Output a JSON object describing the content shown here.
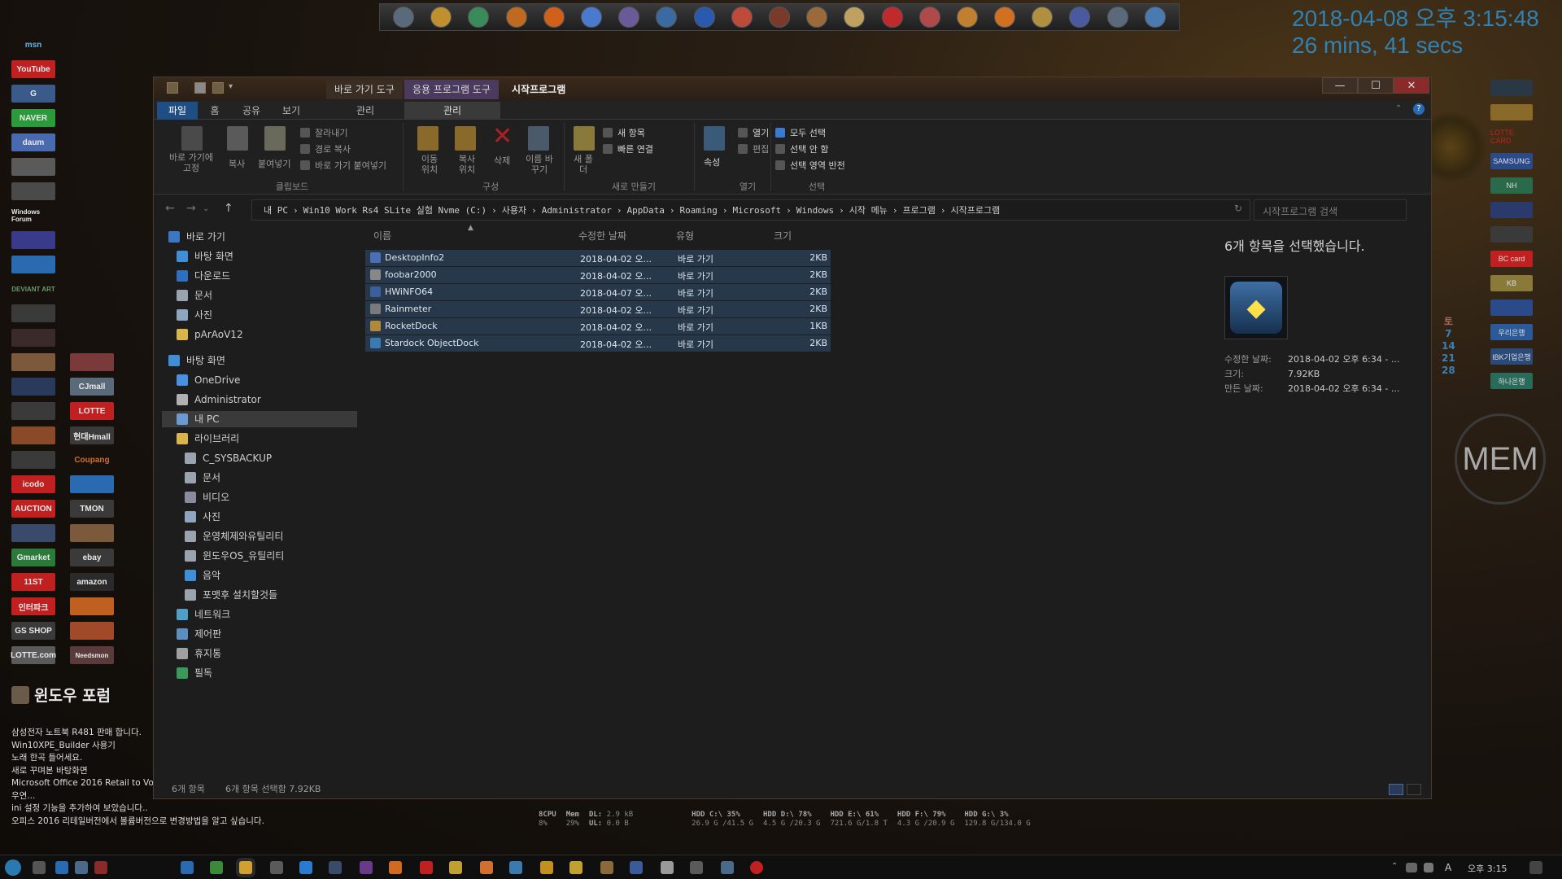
{
  "clock": {
    "datetime": "2018-04-08 오후 3:15:48",
    "uptime": "26 mins, 41 secs"
  },
  "left_shortcuts": [
    "msn",
    "YouTube",
    "G",
    "NAVER",
    "daum",
    "",
    "",
    "Windows Forum",
    "",
    "",
    "DEVIANT ART",
    "",
    "",
    "",
    "",
    "",
    "",
    "",
    "",
    "",
    "",
    "",
    "",
    "",
    "",
    ""
  ],
  "left_shortcuts_col2": [
    "CJmall",
    "LOTTE",
    "현대Hmall",
    "Coupang",
    "",
    "TMON",
    "",
    "ebay",
    "amazon",
    "",
    "",
    "Needsmon"
  ],
  "left_shortcuts_col1b": [
    "icodo",
    "AUCTION",
    "",
    "Gmarket",
    "11ST",
    "인터파크",
    "GS SHOP",
    "LOTTE.com"
  ],
  "right_shortcuts": [
    "",
    "",
    "LOTTE CARD",
    "SAMSUNG",
    "NH",
    "",
    "",
    "BC card",
    "KB",
    "",
    "우리은행",
    "IBK기업은행",
    "하나은행"
  ],
  "calendar": [
    "토",
    "7",
    "14",
    "21",
    "28"
  ],
  "mem_widget": "MEM",
  "forum": {
    "title": "윈도우 포럼",
    "lines": [
      "삼성전자 노트북 R481 판매 합니다.",
      "Win10XPE_Builder 사용기",
      "노래 한곡 들어세요.",
      "새로 꾸며본 바탕화면",
      "Microsoft Office 2016 Retail to Vo",
      "우연...",
      "ini 설정 기능을 추가하여 보았습니다..",
      "오피스 2016 리테일버전에서 볼륨버전으로 변경방법을 알고 싶습니다."
    ]
  },
  "window": {
    "context_tabs": [
      "바로 가기 도구",
      "응용 프로그램 도구"
    ],
    "title": "시작프로그램",
    "controls": {
      "minimize": "—",
      "maximize": "☐",
      "close": "✕"
    },
    "tabs": {
      "file": "파일",
      "home": "홈",
      "share": "공유",
      "view": "보기",
      "manage1": "관리",
      "manage2": "관리"
    },
    "ribbon": {
      "pin": "바로 가기에 고정",
      "copy": "복사",
      "paste": "붙여넣기",
      "cut": "잘라내기",
      "copy_path": "경로 복사",
      "paste_shortcut": "바로 가기 붙여넣기",
      "move_to": "이동 위치",
      "copy_to": "복사 위치",
      "delete": "삭제",
      "rename": "이름 바꾸기",
      "new_folder": "새 폴더",
      "new_item": "새 항목",
      "easy_access": "빠른 연결",
      "properties": "속성",
      "open": "열기",
      "edit": "편집",
      "select_all": "모두 선택",
      "select_none": "선택 안 함",
      "invert_selection": "선택 영역 반전",
      "groups": {
        "clipboard": "클립보드",
        "organize": "구성",
        "new": "새로 만들기",
        "open": "열기",
        "select": "선택"
      }
    },
    "address": {
      "back": "←",
      "forward": "→",
      "dropdown": "⌄",
      "up": "↑",
      "crumbs": [
        "내 PC",
        "Win10 Work Rs4 SLite 실험 Nvme (C:)",
        "사용자",
        "Administrator",
        "AppData",
        "Roaming",
        "Microsoft",
        "Windows",
        "시작 메뉴",
        "프로그램",
        "시작프로그램"
      ],
      "refresh": "↻",
      "search_placeholder": "시작프로그램 검색"
    },
    "nav": [
      {
        "label": "바로 가기",
        "color": "#3b78c4"
      },
      {
        "label": "바탕 화면",
        "color": "#3f8fd8"
      },
      {
        "label": "다운로드",
        "color": "#2f6fbe"
      },
      {
        "label": "문서",
        "color": "#9aa4b0"
      },
      {
        "label": "사진",
        "color": "#8fa6c0"
      },
      {
        "label": "pArAoV12",
        "color": "#d9b54a"
      },
      {
        "label": "바탕 화면",
        "color": "#3f8fd8"
      },
      {
        "label": "OneDrive",
        "color": "#4a90e2"
      },
      {
        "label": "Administrator",
        "color": "#b0b0b0"
      },
      {
        "label": "내 PC",
        "color": "#6a9ad0"
      },
      {
        "label": "라이브러리",
        "color": "#d9b54a"
      },
      {
        "label": "C_SYSBACKUP",
        "color": "#9aa4b0"
      },
      {
        "label": "문서",
        "color": "#9aa4b0"
      },
      {
        "label": "비디오",
        "color": "#8a8aa0"
      },
      {
        "label": "사진",
        "color": "#8fa6c0"
      },
      {
        "label": "운영체제와유틸리티",
        "color": "#9aa4b0"
      },
      {
        "label": "윈도우OS_유틸리티",
        "color": "#9aa4b0"
      },
      {
        "label": "음악",
        "color": "#3f8fd8"
      },
      {
        "label": "포맷후 설치할것들",
        "color": "#9aa4b0"
      },
      {
        "label": "네트워크",
        "color": "#4fa0c8"
      },
      {
        "label": "제어판",
        "color": "#5a8fbf"
      },
      {
        "label": "휴지통",
        "color": "#a0a0a0"
      },
      {
        "label": "필독",
        "color": "#3a9a5a"
      }
    ],
    "columns": {
      "name": "이름",
      "modified": "수정한 날짜",
      "type": "유형",
      "size": "크기"
    },
    "files": [
      {
        "name": "DesktopInfo2",
        "modified": "2018-04-02 오...",
        "type": "바로 가기",
        "size": "2KB",
        "color": "#4a6fb5"
      },
      {
        "name": "foobar2000",
        "modified": "2018-04-02 오...",
        "type": "바로 가기",
        "size": "2KB",
        "color": "#888888"
      },
      {
        "name": "HWiNFO64",
        "modified": "2018-04-07 오...",
        "type": "바로 가기",
        "size": "2KB",
        "color": "#3b5f9a"
      },
      {
        "name": "Rainmeter",
        "modified": "2018-04-02 오...",
        "type": "바로 가기",
        "size": "2KB",
        "color": "#7a7a7a"
      },
      {
        "name": "RocketDock",
        "modified": "2018-04-02 오...",
        "type": "바로 가기",
        "size": "1KB",
        "color": "#b08a3a"
      },
      {
        "name": "Stardock ObjectDock",
        "modified": "2018-04-02 오...",
        "type": "바로 가기",
        "size": "2KB",
        "color": "#3a7ab0"
      }
    ],
    "details": {
      "title": "6개 항목을 선택했습니다.",
      "modified_label": "수정한 날짜:",
      "modified_value": "2018-04-02 오후 6:34 - ...",
      "size_label": "크기:",
      "size_value": "7.92KB",
      "created_label": "만든 날짜:",
      "created_value": "2018-04-02 오후 6:34 - ..."
    },
    "status": {
      "count": "6개 항목",
      "selected": "6개 항목 선택함 7.92KB"
    }
  },
  "stats": [
    {
      "label": "8CPU",
      "value": "8%"
    },
    {
      "label": "Mem",
      "value": "29%"
    },
    {
      "label": "DL:",
      "value": "2.9 kB"
    },
    {
      "label": "UL:",
      "value": "0.0 B"
    },
    {
      "label": "HDD C:\\ 35%",
      "value": "26.9 G /41.5 G"
    },
    {
      "label": "HDD D:\\ 78%",
      "value": "4.5 G /20.3 G"
    },
    {
      "label": "HDD E:\\ 61%",
      "value": "721.6 G/1.8 T"
    },
    {
      "label": "HDD F:\\ 79%",
      "value": "4.3 G /20.9 G"
    },
    {
      "label": "HDD G:\\ 3%",
      "value": "129.8 G/134.0 G"
    }
  ],
  "taskbar": {
    "time": "오후 3:15",
    "ime": "A"
  }
}
